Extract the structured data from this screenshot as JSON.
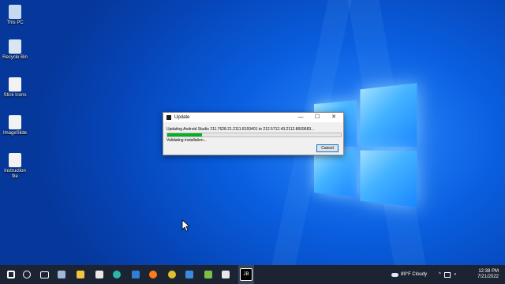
{
  "desktop": {
    "icons": [
      {
        "label": "This PC",
        "name": "this-pc-icon",
        "color": "#c8d8f0"
      },
      {
        "label": "Recycle Bin",
        "name": "recycle-bin-icon",
        "color": "#d9e6f2"
      },
      {
        "label": "Stick Icons",
        "name": "file-icon",
        "color": "#f2f2f2"
      },
      {
        "label": "ImageSlide",
        "name": "file-icon",
        "color": "#f2f2f2"
      },
      {
        "label": "Instruction file",
        "name": "file-icon",
        "color": "#f2f2f2"
      }
    ]
  },
  "dialog": {
    "title": "Update",
    "message": "Updating Android Studio 211.7628.21.2111.8193401 to 212.5712.43.2112.8609683...",
    "status": "Validating installation...",
    "progress": 0.2,
    "cancel_label": "Cancel",
    "minimize_glyph": "—",
    "maximize_glyph": "☐",
    "close_glyph": "✕"
  },
  "taskbar": {
    "pinned": [
      {
        "name": "windows-start-icon",
        "color": "#ffffff"
      },
      {
        "name": "search-icon",
        "color": "#ffffff"
      },
      {
        "name": "task-view-icon",
        "color": "#ffffff"
      },
      {
        "name": "widgets-icon",
        "color": "#9fb6d6"
      },
      {
        "name": "file-explorer-icon",
        "color": "#f3c440"
      },
      {
        "name": "store-icon",
        "color": "#e8e8e8"
      },
      {
        "name": "edge-icon",
        "color": "#2bb8a8"
      },
      {
        "name": "mail-icon",
        "color": "#2f7fd6"
      },
      {
        "name": "firefox-icon",
        "color": "#ff7a1a"
      },
      {
        "name": "chrome-icon",
        "color": "#e0c030"
      },
      {
        "name": "photos-icon",
        "color": "#3a8be0"
      },
      {
        "name": "android-studio-icon",
        "color": "#7ac043"
      },
      {
        "name": "jetbrains-icon",
        "color": "#e8e8e8"
      },
      {
        "name": "jb-updater-icon",
        "color": "#000000",
        "label": "JB"
      }
    ],
    "weather": "89°F Cloudy",
    "time": "12:38 PM",
    "date": "7/21/2022"
  }
}
